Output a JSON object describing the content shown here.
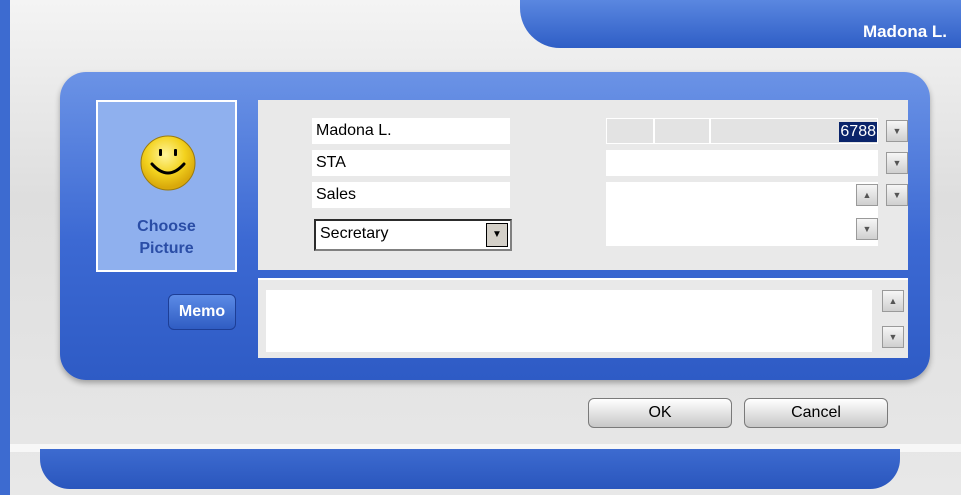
{
  "window": {
    "title": "Madona L."
  },
  "picture": {
    "label": "Choose\nPicture"
  },
  "form": {
    "name": "Madona L.",
    "field2": "STA",
    "field3": "Sales",
    "role_selected": "Secretary"
  },
  "phone": {
    "value": "6788"
  },
  "memo": {
    "label": "Memo"
  },
  "buttons": {
    "ok": "OK",
    "cancel": "Cancel"
  },
  "colors": {
    "accent": "#3c69d3",
    "panel_fill": "#e9e9e9",
    "title_text": "#ffffff"
  }
}
